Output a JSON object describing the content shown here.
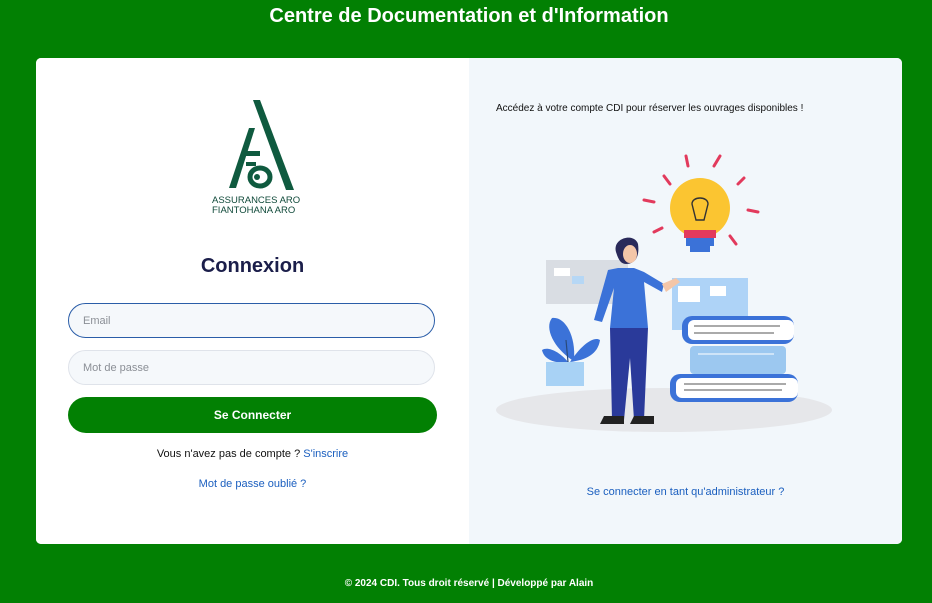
{
  "header": {
    "title": "Centre de Documentation et d'Information"
  },
  "brand": {
    "line1": "ASSURANCES ARO",
    "line2": "FIANTOHANA ARO"
  },
  "login": {
    "title": "Connexion",
    "email_placeholder": "Email",
    "password_placeholder": "Mot de passe",
    "submit_label": "Se Connecter",
    "no_account_text": "Vous n'avez pas de compte ?",
    "signup_link": "S'inscrire",
    "forgot_link": "Mot de passe oublié ?"
  },
  "aside": {
    "tagline": "Accédez à votre compte CDI pour réserver les ouvrages disponibles !",
    "admin_link": "Se connecter en tant qu'administrateur ?"
  },
  "footer": {
    "text": "© 2024 CDI. Tous droit réservé | Développé par Alain"
  },
  "colors": {
    "brand_green": "#028003",
    "panel_bg": "#f2f7fb",
    "link_blue": "#1b5fbf",
    "logo_green": "#0f5a3f",
    "title_navy": "#1b1e4a"
  }
}
